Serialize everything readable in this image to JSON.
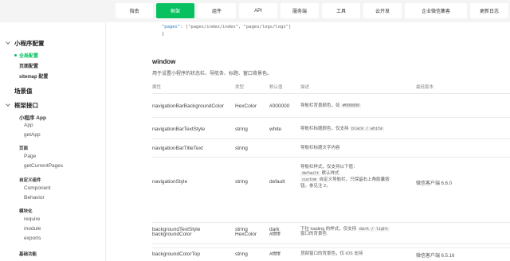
{
  "nav": {
    "tabs": [
      "指南",
      "框架",
      "组件",
      "API",
      "服务端",
      "工具",
      "云开发",
      "企业微信集客",
      "更新日志"
    ],
    "active_index": 1
  },
  "sidebar": {
    "mini_config": "小程序配置",
    "global_config": "全局配置",
    "page_config": "页面配置",
    "sitemap_config": "sitemap 配置",
    "scene": "场景值",
    "framework_api": "框架接口",
    "mini_app": "小程序 App",
    "app": "App",
    "get_app": "getApp",
    "page_group": "页面",
    "page": "Page",
    "get_current_pages": "getCurrentPages",
    "custom_component": "自定义组件",
    "component": "Component",
    "behavior": "Behavior",
    "modularization": "模块化",
    "require": "require",
    "module": "module",
    "exports": "exports",
    "basic_func": "基础功能"
  },
  "code": {
    "line1_key": "\"pages\"",
    "line1_val": ": [\"pages/index/index\", \"pages/logs/logs\"]",
    "line2": "}"
  },
  "section": {
    "title": "window",
    "desc": "用于设置小程序的状态栏、导航条、标题、窗口背景色。"
  },
  "table": {
    "headers": [
      "属性",
      "类型",
      "默认值",
      "描述",
      "最低版本"
    ],
    "rows": [
      {
        "prop": "navigationBarBackgroundColor",
        "type": "HexColor",
        "default": "#000000",
        "desc": "导航栏背景颜色，如",
        "code": "#000000",
        "ver": ""
      },
      {
        "prop": "navigationBarTextStyle",
        "type": "string",
        "default": "white",
        "desc": "导航栏标题颜色，仅支持",
        "code": "black / white",
        "ver": ""
      },
      {
        "prop": "navigationBarTitleText",
        "type": "string",
        "default": "",
        "desc": "导航栏标题文字内容",
        "code": "",
        "ver": ""
      },
      {
        "prop": "navigationStyle",
        "type": "string",
        "default": "default",
        "desc": "导航栏样式，仅支持以下值：",
        "desc2_code": "default",
        "desc2": "默认样式",
        "desc3_code": "custom",
        "desc3": "自定义导航栏，只保留右上角胶囊按",
        "desc4": "钮。参见注 2。",
        "ver": "微信客户端 6.6.0"
      },
      {
        "prop": "backgroundColor",
        "type": "HexColor",
        "default": "#ffffff",
        "desc": "窗口的背景色",
        "code": "",
        "ver": ""
      },
      {
        "prop": "backgroundTextStyle",
        "type": "string",
        "default": "dark",
        "desc": "下拉 loading 的样式，仅支持",
        "code": "dark / light",
        "ver": ""
      },
      {
        "prop": "backgroundColorTop",
        "type": "string",
        "default": "#ffffff",
        "desc": "顶部窗口的背景色，仅 iOS 支持",
        "code": "",
        "ver": "微信客户端 6.5.16"
      }
    ]
  },
  "colors": {
    "accent": "#07c160",
    "nav_bg": "#f4f4f4"
  }
}
